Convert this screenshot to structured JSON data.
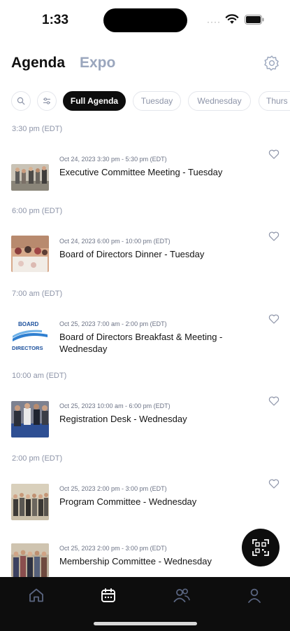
{
  "status": {
    "time": "1:33",
    "dots": "····"
  },
  "header": {
    "tab_agenda": "Agenda",
    "tab_expo": "Expo",
    "settings_icon": "gear-icon"
  },
  "filters": {
    "search_icon": "search-icon",
    "filter_icon": "sliders-icon",
    "chips": [
      "Full Agenda",
      "Tuesday",
      "Wednesday",
      "Thurs"
    ],
    "active": "Full Agenda"
  },
  "agenda": {
    "groups": [
      {
        "time": "3:30 pm (EDT)",
        "date": "Oct 24, 2023  3:30 pm - 5:30 pm (EDT)",
        "title": "Executive Committee Meeting - Tuesday"
      },
      {
        "time": "6:00 pm (EDT)",
        "date": "Oct 24, 2023  6:00 pm - 10:00 pm (EDT)",
        "title": "Board of Directors Dinner - Tuesday"
      },
      {
        "time": "7:00 am (EDT)",
        "date": "Oct 25, 2023  7:00 am - 2:00 pm (EDT)",
        "title": "Board of Directors Breakfast & Meeting - Wednesday",
        "logo_text": [
          "BOARD",
          "DIRECTORS"
        ]
      },
      {
        "time": "10:00 am (EDT)",
        "date": "Oct 25, 2023 10:00 am - 6:00 pm (EDT)",
        "title": "Registration Desk - Wednesday"
      },
      {
        "time": "2:00 pm (EDT)",
        "date": "Oct 25, 2023  2:00 pm - 3:00 pm (EDT)",
        "title": "Program Committee - Wednesday"
      },
      {
        "time": "",
        "date": "Oct 25, 2023  2:00 pm - 3:00 pm (EDT)",
        "title": "Membership Committee - Wednesday"
      }
    ]
  },
  "fab": {
    "icon": "qr-scan-icon"
  },
  "nav": {
    "items": [
      "home-icon",
      "calendar-icon",
      "people-icon",
      "profile-icon"
    ],
    "active": "calendar-icon"
  },
  "colors": {
    "accent_dark": "#0d0d0d",
    "muted": "#8d94a8",
    "expo_tab": "#9aa6bd"
  }
}
